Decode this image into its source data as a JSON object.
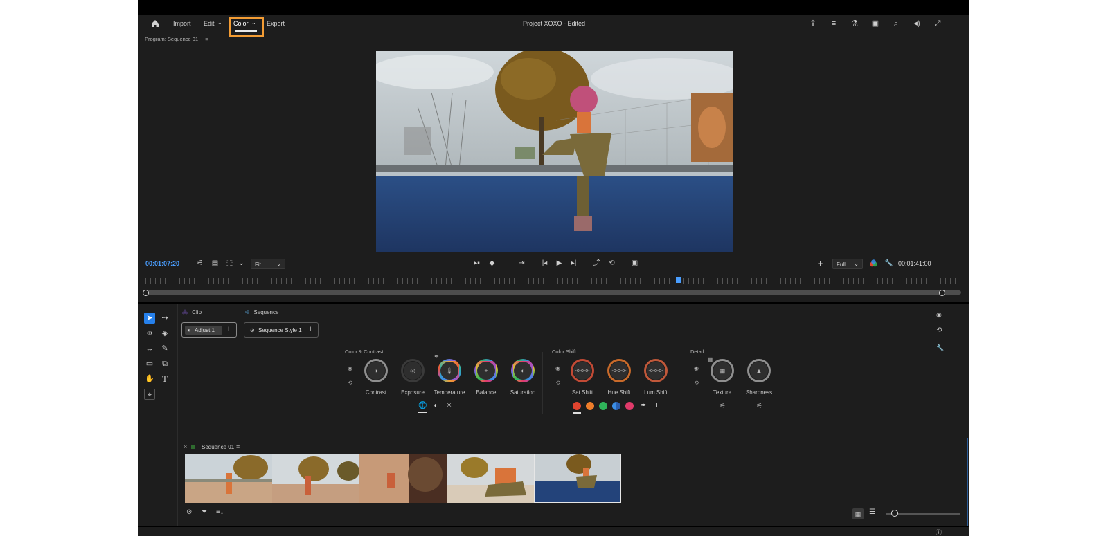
{
  "menu": {
    "home": "home-icon",
    "import": "Import",
    "edit": "Edit",
    "color": "Color",
    "export": "Export"
  },
  "project_title": "Project XOXO - Edited",
  "program_monitor": {
    "title": "Program: Sequence 01",
    "timecode_current": "00:01:07:20",
    "timecode_duration": "00:01:41:00",
    "zoom_select": "Fit",
    "resolution_select": "Full"
  },
  "color_panel": {
    "tab_clip": "Clip",
    "tab_sequence": "Sequence",
    "clip_layer": "Adjust 1",
    "sequence_layer": "Sequence Style 1",
    "add": "+",
    "groups": {
      "color_contrast": "Color & Contrast",
      "color_shift": "Color Shift",
      "detail": "Detail"
    },
    "controls": {
      "contrast": "Contrast",
      "exposure": "Exposure",
      "temperature": "Temperature",
      "balance": "Balance",
      "saturation": "Saturation",
      "sat_shift": "Sat Shift",
      "hue_shift": "Hue Shift",
      "lum_shift": "Lum Shift",
      "texture": "Texture",
      "sharpness": "Sharpness"
    },
    "swatch_colors": [
      "#e0442f",
      "#ee7d2a",
      "#2fb35a",
      "#3b8ee6",
      "#e03a6a"
    ]
  },
  "timeline": {
    "title": "Sequence 01",
    "close": "×"
  },
  "accent_color": "#f39c34",
  "selection_color": "#2680eb"
}
